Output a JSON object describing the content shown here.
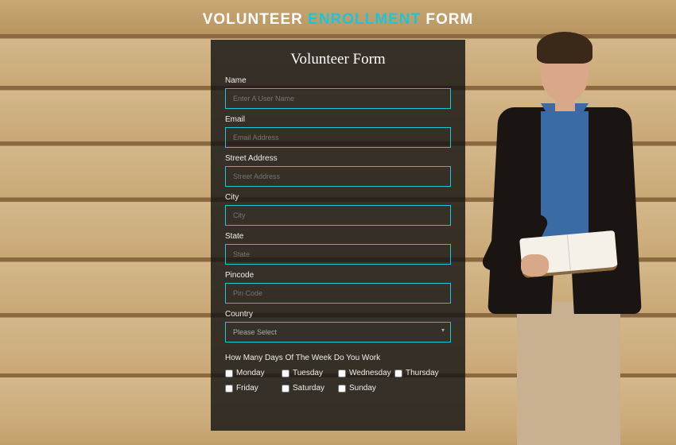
{
  "header": {
    "title_part1": "VOLUNTEER ",
    "title_accent": "ENROLLMENT",
    "title_part2": " FORM"
  },
  "form": {
    "heading": "Volunteer Form",
    "fields": {
      "name": {
        "label": "Name",
        "placeholder": "Enter A User Name"
      },
      "email": {
        "label": "Email",
        "placeholder": "Email Address"
      },
      "street": {
        "label": "Street Address",
        "placeholder": "Street Address"
      },
      "city": {
        "label": "City",
        "placeholder": "City"
      },
      "state": {
        "label": "State",
        "placeholder": "State"
      },
      "pincode": {
        "label": "Pincode",
        "placeholder": "Pin Code"
      },
      "country": {
        "label": "Country",
        "placeholder": "Please Select"
      }
    },
    "days_question": "How Many Days Of The Week Do You Work",
    "days": [
      "Monday",
      "Tuesday",
      "Wednesday",
      "Thursday",
      "Friday",
      "Saturday",
      "Sunday"
    ]
  },
  "colors": {
    "accent": "#1fc4d6",
    "panel_bg": "rgba(20,20,20,0.82)"
  }
}
